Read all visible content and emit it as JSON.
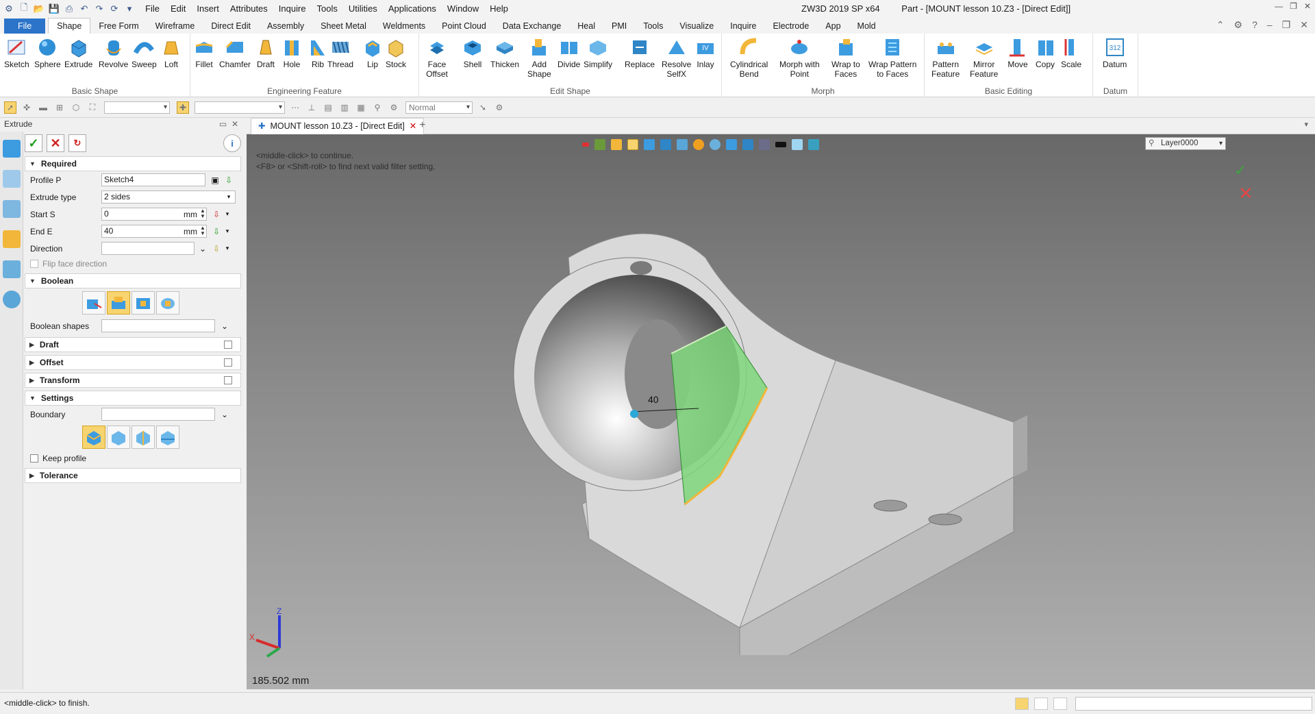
{
  "app": {
    "product": "ZW3D 2019 SP x64",
    "window_title": "Part - [MOUNT lesson 10.Z3 - [Direct Edit]]"
  },
  "menu": [
    "File",
    "Edit",
    "Insert",
    "Attributes",
    "Inquire",
    "Tools",
    "Utilities",
    "Applications",
    "Window",
    "Help"
  ],
  "ribbon_tabs": [
    "File",
    "Shape",
    "Free Form",
    "Wireframe",
    "Direct Edit",
    "Assembly",
    "Sheet Metal",
    "Weldments",
    "Point Cloud",
    "Data Exchange",
    "Heal",
    "PMI",
    "Tools",
    "Visualize",
    "Inquire",
    "Electrode",
    "App",
    "Mold"
  ],
  "ribbon": {
    "basic_shape": {
      "name": "Basic Shape",
      "buttons": [
        "Sketch",
        "Sphere",
        "Extrude",
        "Revolve",
        "Sweep",
        "Loft"
      ]
    },
    "engineering_feature": {
      "name": "Engineering Feature",
      "buttons": [
        "Fillet",
        "Chamfer",
        "Draft",
        "Hole",
        "Rib",
        "Thread",
        "Lip",
        "Stock"
      ]
    },
    "edit_shape": {
      "name": "Edit Shape",
      "buttons": [
        {
          "l1": "Face",
          "l2": "Offset"
        },
        {
          "l1": "Shell",
          "l2": ""
        },
        {
          "l1": "Thicken",
          "l2": ""
        },
        {
          "l1": "Add",
          "l2": "Shape"
        },
        {
          "l1": "Divide",
          "l2": ""
        },
        {
          "l1": "Simplify",
          "l2": ""
        },
        {
          "l1": "Replace",
          "l2": ""
        },
        {
          "l1": "Resolve",
          "l2": "SelfX"
        },
        {
          "l1": "Inlay",
          "l2": ""
        }
      ]
    },
    "morph": {
      "name": "Morph",
      "buttons": [
        {
          "l1": "Cylindrical",
          "l2": "Bend"
        },
        {
          "l1": "Morph with",
          "l2": "Point"
        },
        {
          "l1": "Wrap to",
          "l2": "Faces"
        },
        {
          "l1": "Wrap Pattern",
          "l2": "to Faces"
        }
      ]
    },
    "basic_editing": {
      "name": "Basic Editing",
      "buttons": [
        {
          "l1": "Pattern",
          "l2": "Feature"
        },
        {
          "l1": "Mirror",
          "l2": "Feature"
        },
        {
          "l1": "Move",
          "l2": ""
        },
        {
          "l1": "Copy",
          "l2": ""
        },
        {
          "l1": "Scale",
          "l2": ""
        }
      ]
    },
    "datum": {
      "name": "Datum",
      "buttons": [
        "Datum"
      ]
    }
  },
  "toolbar2": {
    "filter_value": "Normal"
  },
  "panel": {
    "title": "Extrude",
    "sections": {
      "required": "Required",
      "boolean": "Boolean",
      "draft": "Draft",
      "offset": "Offset",
      "transform": "Transform",
      "settings": "Settings",
      "tolerance": "Tolerance"
    },
    "fields": {
      "profile_label": "Profile P",
      "profile_value": "Sketch4",
      "extrude_type_label": "Extrude type",
      "extrude_type_value": "2 sides",
      "start_label": "Start S",
      "start_value": "0",
      "start_unit": "mm",
      "end_label": "End E",
      "end_value": "40",
      "end_unit": "mm",
      "direction_label": "Direction",
      "flip_label": "Flip face direction",
      "boolean_shapes_label": "Boolean shapes",
      "boundary_label": "Boundary",
      "keep_profile_label": "Keep profile"
    }
  },
  "document_tab": "MOUNT lesson 10.Z3 - [Direct Edit]",
  "viewport": {
    "hint_line1": "<middle-click> to continue.",
    "hint_line2": "<F8> or <Shift-roll> to find next valid filter setting.",
    "layer": "Layer0000",
    "dimension_label": "40",
    "measure": "185.502 mm",
    "axis_x": "X",
    "axis_z": "Z"
  },
  "status": {
    "message": "<middle-click> to finish."
  },
  "colors": {
    "accent": "#2b74c9",
    "selection_green": "#7ed67a",
    "part_gray": "#d9d9d9"
  }
}
